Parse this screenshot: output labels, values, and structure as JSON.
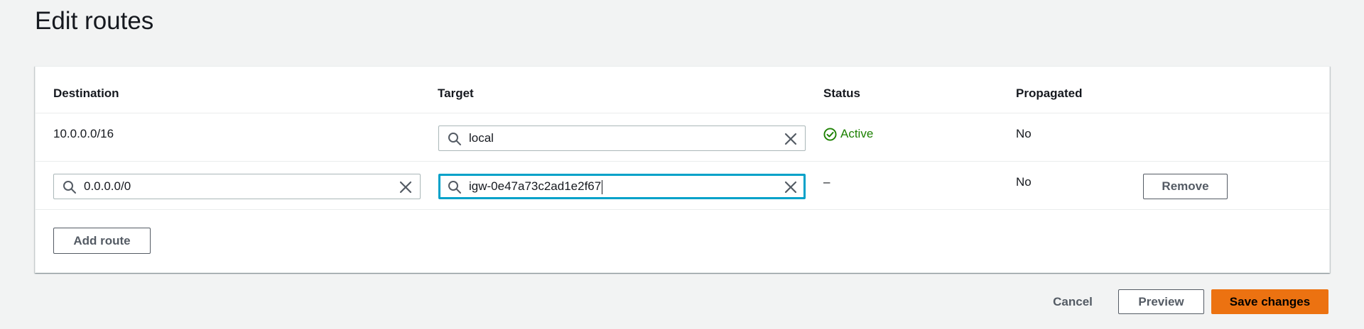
{
  "page": {
    "title": "Edit routes"
  },
  "table": {
    "columns": [
      "Destination",
      "Target",
      "Status",
      "Propagated"
    ],
    "rows": [
      {
        "destination": "10.0.0.0/16",
        "target": "local",
        "status": "Active",
        "propagated": "No"
      },
      {
        "destination": "0.0.0.0/0",
        "target": "igw-0e47a73c2ad1e2f67",
        "status": "–",
        "propagated": "No",
        "remove_label": "Remove"
      }
    ],
    "add_route_label": "Add route"
  },
  "footer": {
    "cancel_label": "Cancel",
    "preview_label": "Preview",
    "save_label": "Save changes"
  },
  "colors": {
    "primary": "#ec7211",
    "focus": "#00a1c9",
    "success": "#1d8102",
    "background": "#f2f3f3"
  },
  "icons": {
    "search": "search-icon",
    "clear": "close-icon",
    "status_ok": "check-circle-icon"
  }
}
